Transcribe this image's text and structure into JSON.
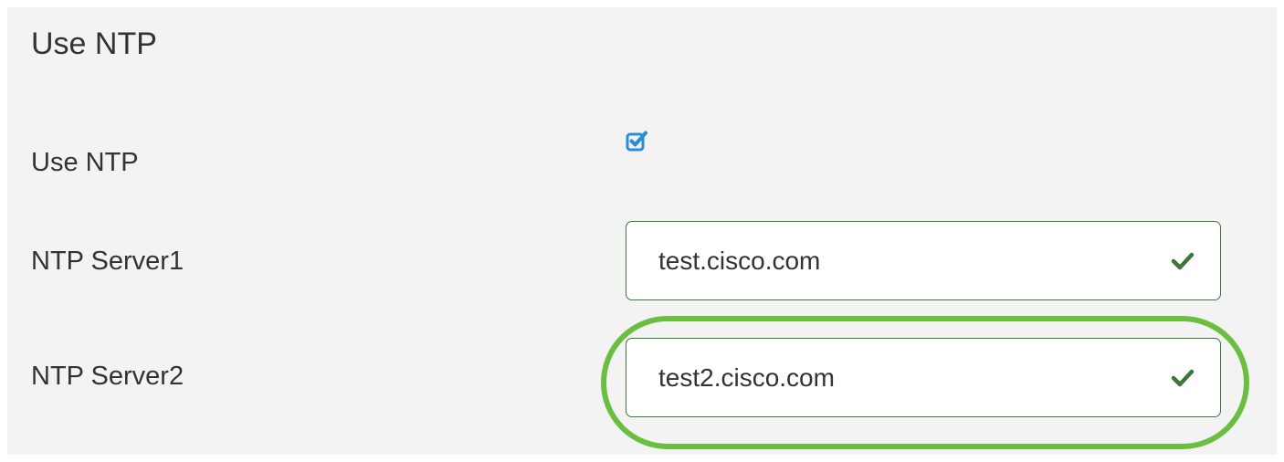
{
  "section": {
    "title": "Use NTP"
  },
  "fields": {
    "use_ntp": {
      "label": "Use NTP",
      "checked": true
    },
    "ntp_server1": {
      "label": "NTP Server1",
      "value": "test.cisco.com",
      "valid": true
    },
    "ntp_server2": {
      "label": "NTP Server2",
      "value": "test2.cisco.com",
      "valid": true
    }
  },
  "colors": {
    "panel_bg": "#f3f3f3",
    "text": "#333333",
    "checkbox_blue": "#2a8dd4",
    "valid_green": "#3c763d",
    "highlight_green": "#6abf40"
  },
  "icons": {
    "checkbox": "checkbox-checked-icon",
    "valid": "checkmark-icon",
    "annotation": "highlight-ellipse"
  }
}
